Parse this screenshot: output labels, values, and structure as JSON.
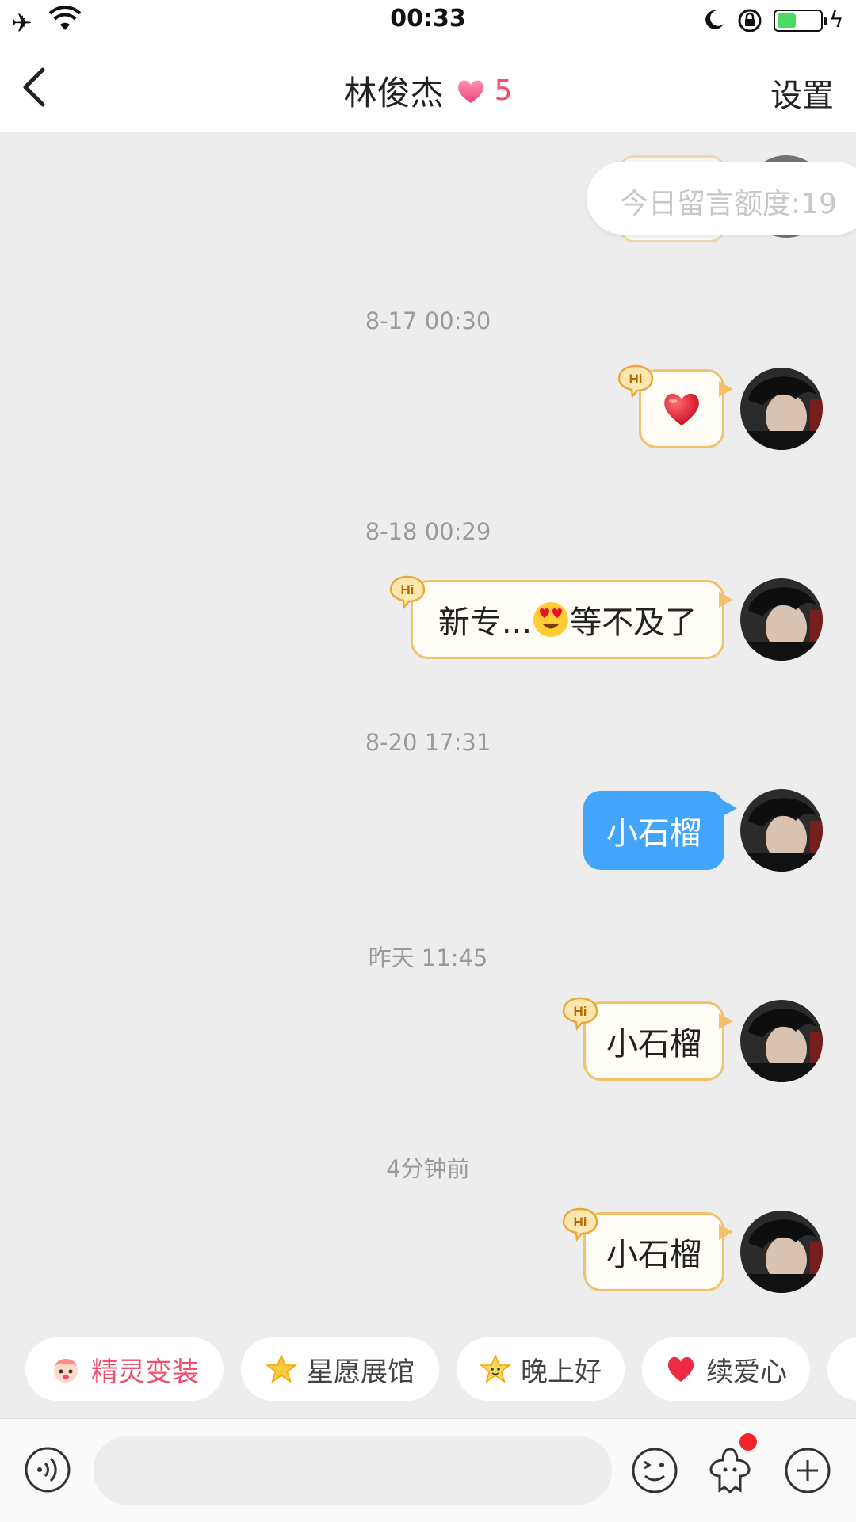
{
  "status_bar": {
    "time": "00:33",
    "battery_level": 0.45
  },
  "nav": {
    "title": "林俊杰",
    "heart_count": "5",
    "settings_label": "设置"
  },
  "quota_label": "今日留言额度:19",
  "messages": [
    {
      "timestamp": "8-17 00:30",
      "type": "special",
      "content": "",
      "emoji": "red-heart"
    },
    {
      "timestamp": "8-18 00:29",
      "type": "special",
      "content_before": "新专...",
      "emoji": "heart-eyes-face",
      "content_after": "等不及了"
    },
    {
      "timestamp": "8-20 17:31",
      "type": "normal",
      "content": "小石榴"
    },
    {
      "timestamp": "昨天 11:45",
      "type": "special",
      "content": "小石榴"
    },
    {
      "timestamp": "4分钟前",
      "type": "special",
      "content": "小石榴"
    }
  ],
  "badge_text": "Hi",
  "chips": [
    {
      "label": "精灵变装",
      "icon": "spirit-face-icon"
    },
    {
      "label": "星愿展馆",
      "icon": "star-icon"
    },
    {
      "label": "晚上好",
      "icon": "star-face-icon"
    },
    {
      "label": "续爱心",
      "icon": "heart-icon"
    }
  ],
  "input": {
    "placeholder": ""
  },
  "colors": {
    "accent_pink": "#f04e6e",
    "bubble_blue": "#42a5fa",
    "special_border": "#f1c26b",
    "background": "#ededed"
  }
}
